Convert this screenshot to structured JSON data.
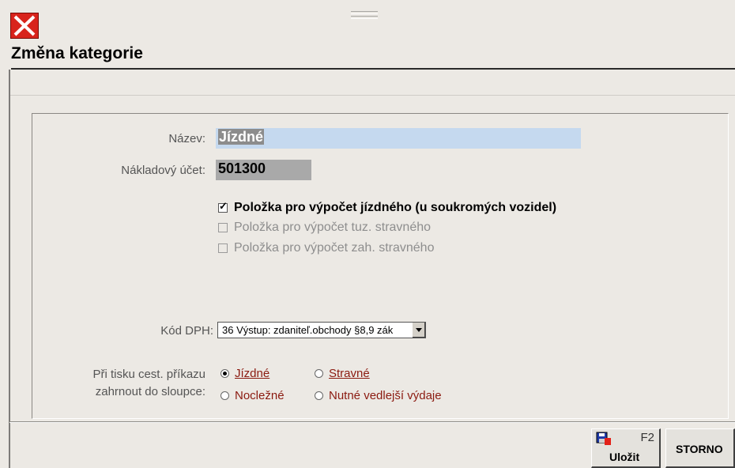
{
  "dialog": {
    "title": "Změna kategorie"
  },
  "form": {
    "nazev_label": "Název:",
    "nazev_value": "Jízdné",
    "ucet_label": "Nákladový účet:",
    "ucet_value": "501300",
    "checkboxes": [
      {
        "label": "Položka pro výpočet jízdného (u soukromých vozidel)",
        "checked": true,
        "enabled": true
      },
      {
        "label": "Položka pro výpočet tuz. stravného",
        "checked": false,
        "enabled": false
      },
      {
        "label": "Položka pro výpočet zah. stravného",
        "checked": false,
        "enabled": false
      }
    ],
    "dph_label": "Kód DPH:",
    "dph_value": "36  Výstup: zdaniteľ.obchody §8,9 zák",
    "print_label_line1": "Při tisku cest. příkazu",
    "print_label_line2": "zahrnout do sloupce:",
    "radios": [
      {
        "label": "Jízdné",
        "selected": true
      },
      {
        "label": "Stravné",
        "selected": false
      },
      {
        "label": "Nocležné",
        "selected": false
      },
      {
        "label": "Nutné vedlejší výdaje",
        "selected": false
      }
    ]
  },
  "buttons": {
    "save_label": "Uložit",
    "save_shortcut": "F2",
    "cancel_label": "STORNO"
  },
  "colors": {
    "close_red": "#d8241c",
    "name_field_bg": "#c5d9ef",
    "account_field_bg": "#a9a9a9",
    "radio_text": "#8b1a10"
  },
  "icons": {
    "close": "close-x-icon",
    "save": "save-disk-icon",
    "grip": "drag-grip-icon"
  }
}
